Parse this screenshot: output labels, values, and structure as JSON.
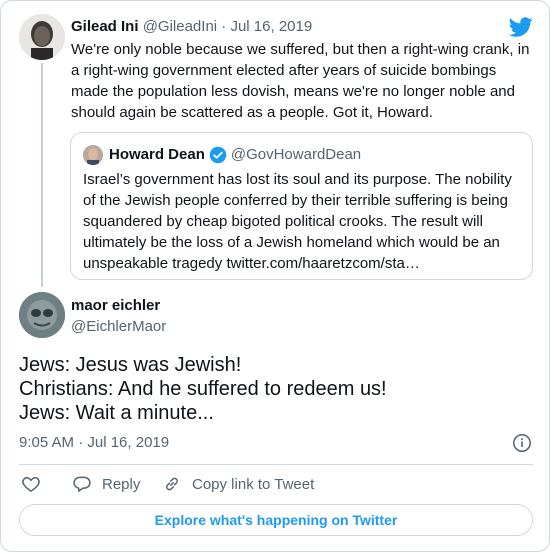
{
  "parent_tweet": {
    "name": "Gilead Ini",
    "handle": "@GileadIni",
    "separator": "·",
    "date": "Jul 16, 2019",
    "text": "We're only noble because we suffered, but then a right-wing crank, in a right-wing government elected after years of suicide bombings made the population less dovish, means we're no longer noble and should again be scattered as a people. Got it, Howard."
  },
  "quoted_tweet": {
    "name": "Howard Dean",
    "handle": "@GovHowardDean",
    "text": "Israel’s government has lost its soul and its purpose. The nobility of the Jewish people conferred by their terrible suffering is being squandered by cheap bigoted political crooks. The result will ultimately be the loss of a Jewish homeland which would be an unspeakable tragedy twitter.com/haaretzcom/sta…"
  },
  "main_tweet": {
    "name": "maor eichler",
    "handle": "@EichlerMaor",
    "lines": [
      "Jews: Jesus was Jewish!",
      "Christians: And he suffered to redeem us!",
      "Jews: Wait a minute..."
    ],
    "timestamp": "9:05 AM · Jul 16, 2019"
  },
  "actions": {
    "reply_label": "Reply",
    "copy_label": "Copy link to Tweet"
  },
  "explore_label": "Explore what's happening on Twitter",
  "icons": {
    "logo": "twitter-bird-icon",
    "verified": "verified-badge-icon",
    "info": "info-icon",
    "like": "heart-icon",
    "reply": "speech-bubble-icon",
    "copy": "link-icon"
  },
  "colors": {
    "accent": "#1d9bf0",
    "text": "#0f1419",
    "muted": "#536471",
    "border": "#cfd9de"
  }
}
